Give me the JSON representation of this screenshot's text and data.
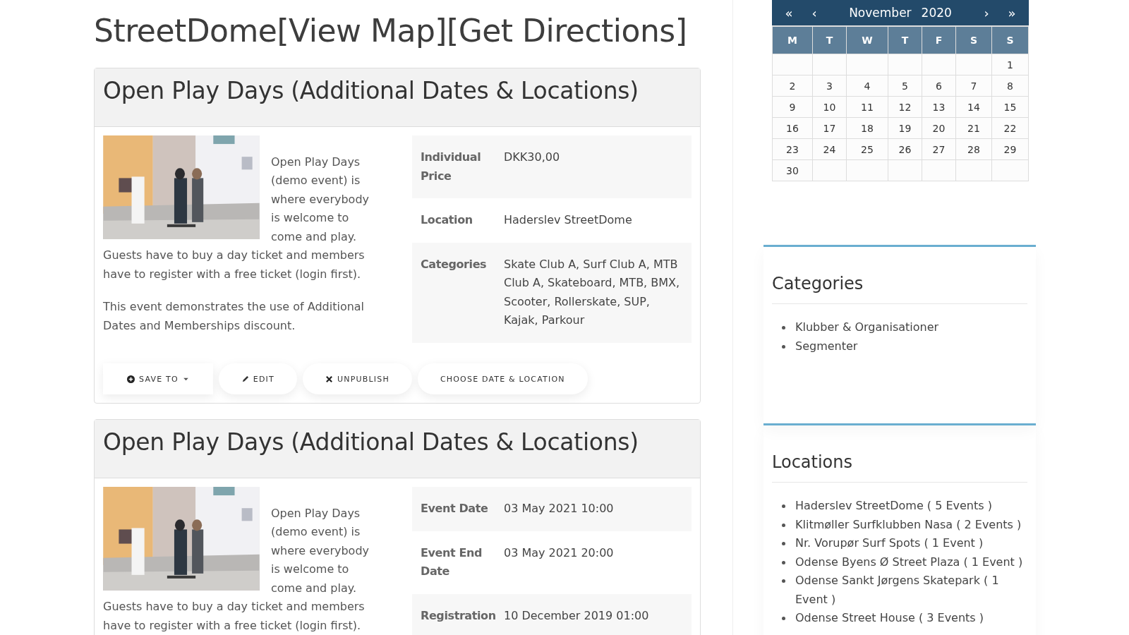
{
  "page_title": "StreetDome[View Map][Get Directions]",
  "events": [
    {
      "title": "Open Play Days (Additional Dates & Locations)",
      "image": {
        "kind": "picture"
      },
      "beside_image": "Open Play Days (demo event) is where everybody is welcome to come and play.",
      "description": [
        "Guests have to buy a day ticket and members have to register with a free ticket (login first).",
        "This event demonstrates the use of Additional Dates and Memberships discount."
      ],
      "details": [
        {
          "label": "Individual Price",
          "value": "DKK30,00"
        },
        {
          "label": "Location",
          "value": "Haderslev StreetDome"
        },
        {
          "label": "Categories",
          "value": "Skate Club A, Surf Club A, MTB Club A, Skateboard, MTB, BMX, Scooter, Rollerskate, SUP, Kajak, Parkour"
        }
      ],
      "actions": [
        {
          "kind": "save",
          "label": "SAVE TO"
        },
        {
          "kind": "edit",
          "label": "EDIT"
        },
        {
          "kind": "unpublish",
          "label": "UNPUBLISH"
        },
        {
          "kind": "plain",
          "label": "CHOOSE DATE & LOCATION"
        }
      ]
    },
    {
      "title": "Open Play Days (Additional Dates & Locations)",
      "image": {
        "kind": "picture"
      },
      "beside_image": "Open Play Days (demo event) is where everybody is welcome to come and play.",
      "description": [
        "Guests have to buy a day ticket and members have to register with a free ticket (login first)."
      ],
      "details": [
        {
          "label": "Event Date",
          "value": "03 May 2021 10:00"
        },
        {
          "label": "Event End Date",
          "value": "03 May 2021 20:00"
        },
        {
          "label": "Registration",
          "value": "10 December 2019 01:00"
        }
      ]
    }
  ],
  "calendar": {
    "nav": [
      "«",
      "‹",
      "›",
      "»"
    ],
    "month": "November",
    "year": "2020",
    "weekdays": [
      "M",
      "T",
      "W",
      "T",
      "F",
      "S",
      "S"
    ],
    "weeks": [
      [
        {
          "kind": "blank"
        },
        {
          "kind": "blank"
        },
        {
          "kind": "blank"
        },
        {
          "kind": "blank"
        },
        {
          "kind": "blank"
        },
        {
          "kind": "blank"
        },
        {
          "kind": "day",
          "label": "1"
        }
      ],
      [
        {
          "kind": "day",
          "label": "2"
        },
        {
          "kind": "day",
          "label": "3"
        },
        {
          "kind": "day",
          "label": "4"
        },
        {
          "kind": "day",
          "label": "5"
        },
        {
          "kind": "day",
          "label": "6"
        },
        {
          "kind": "day",
          "label": "7"
        },
        {
          "kind": "day",
          "label": "8"
        }
      ],
      [
        {
          "kind": "day",
          "label": "9"
        },
        {
          "kind": "day",
          "label": "10"
        },
        {
          "kind": "day",
          "label": "11"
        },
        {
          "kind": "day",
          "label": "12"
        },
        {
          "kind": "day",
          "label": "13"
        },
        {
          "kind": "day",
          "label": "14"
        },
        {
          "kind": "day",
          "label": "15"
        }
      ],
      [
        {
          "kind": "day",
          "label": "16"
        },
        {
          "kind": "day",
          "label": "17"
        },
        {
          "kind": "day",
          "label": "18"
        },
        {
          "kind": "day",
          "label": "19"
        },
        {
          "kind": "day",
          "label": "20"
        },
        {
          "kind": "day",
          "label": "21"
        },
        {
          "kind": "day",
          "label": "22"
        }
      ],
      [
        {
          "kind": "day",
          "label": "23"
        },
        {
          "kind": "day",
          "label": "24"
        },
        {
          "kind": "day",
          "label": "25"
        },
        {
          "kind": "day",
          "label": "26"
        },
        {
          "kind": "day",
          "label": "27"
        },
        {
          "kind": "day",
          "label": "28"
        },
        {
          "kind": "day",
          "label": "29"
        }
      ],
      [
        {
          "kind": "day",
          "label": "30"
        },
        {
          "kind": "blank"
        },
        {
          "kind": "blank"
        },
        {
          "kind": "blank"
        },
        {
          "kind": "blank"
        },
        {
          "kind": "blank"
        },
        {
          "kind": "blank"
        }
      ]
    ]
  },
  "widgets": [
    {
      "title": "Categories",
      "items": [
        "Klubber & Organisationer",
        "Segmenter"
      ]
    },
    {
      "title": "Locations",
      "items": [
        "Haderslev StreetDome ( 5 Events )",
        "Klitmøller Surfklubben Nasa ( 2 Events )",
        "Nr. Vorupør Surf Spots ( 1 Event )",
        "Odense Byens Ø Street Plaza ( 1 Event )",
        "Odense Sankt Jørgens Skatepark ( 1 Event )",
        "Odense Street House ( 3 Events )"
      ]
    }
  ]
}
